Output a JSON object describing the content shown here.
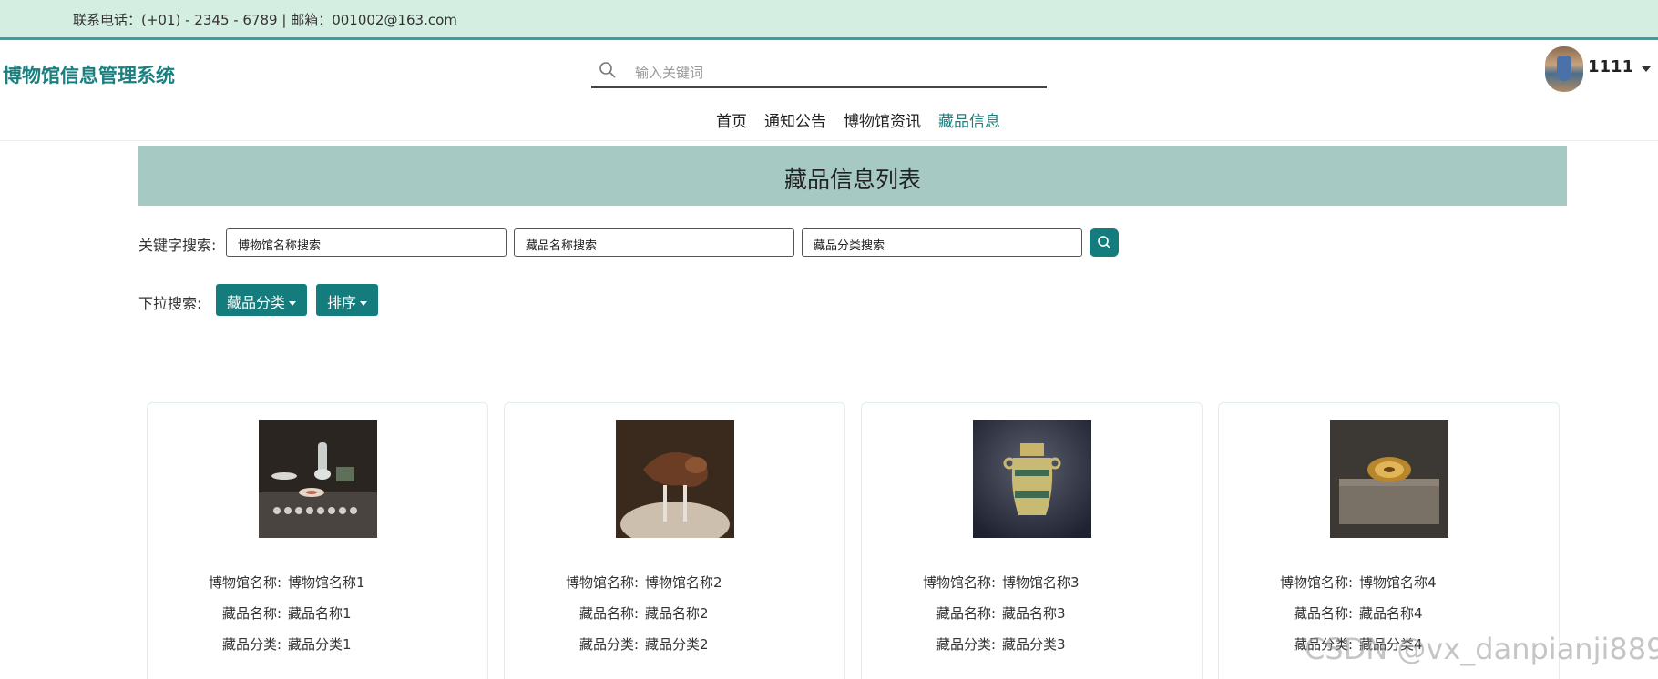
{
  "topbar": {
    "contact": "联系电话：(+01) - 2345 - 6789 | 邮箱：001002@163.com"
  },
  "header": {
    "brand": "博物馆信息管理系统",
    "search_placeholder": "输入关键词",
    "username": "1111",
    "nav": [
      {
        "label": "首页",
        "active": false
      },
      {
        "label": "通知公告",
        "active": false
      },
      {
        "label": "博物馆资讯",
        "active": false
      },
      {
        "label": "藏品信息",
        "active": true
      }
    ]
  },
  "banner": {
    "title": "藏品信息列表"
  },
  "filters": {
    "keyword_label": "关键字搜索:",
    "inputs": [
      "博物馆名称搜索",
      "藏品名称搜索",
      "藏品分类搜索"
    ],
    "dropdown_label": "下拉搜索:",
    "dropdowns": [
      "藏品分类",
      "排序"
    ]
  },
  "cards": [
    {
      "museum_label": "博物馆名称:",
      "museum": "博物馆名称1",
      "name_label": "藏品名称:",
      "name": "藏品名称1",
      "category_label": "藏品分类:",
      "category": "藏品分类1"
    },
    {
      "museum_label": "博物馆名称:",
      "museum": "博物馆名称2",
      "name_label": "藏品名称:",
      "name": "藏品名称2",
      "category_label": "藏品分类:",
      "category": "藏品分类2"
    },
    {
      "museum_label": "博物馆名称:",
      "museum": "博物馆名称3",
      "name_label": "藏品名称:",
      "name": "藏品名称3",
      "category_label": "藏品分类:",
      "category": "藏品分类3"
    },
    {
      "museum_label": "博物馆名称:",
      "museum": "博物馆名称4",
      "name_label": "藏品名称:",
      "name": "藏品名称4",
      "category_label": "藏品分类:",
      "category": "藏品分类4"
    }
  ],
  "watermark": "CSDN @vx_danpianji889",
  "colors": {
    "accent": "#147c7c",
    "topbar_bg": "#d4efe2",
    "banner_bg": "#a6c9c3",
    "brand": "#1b7f7f"
  }
}
